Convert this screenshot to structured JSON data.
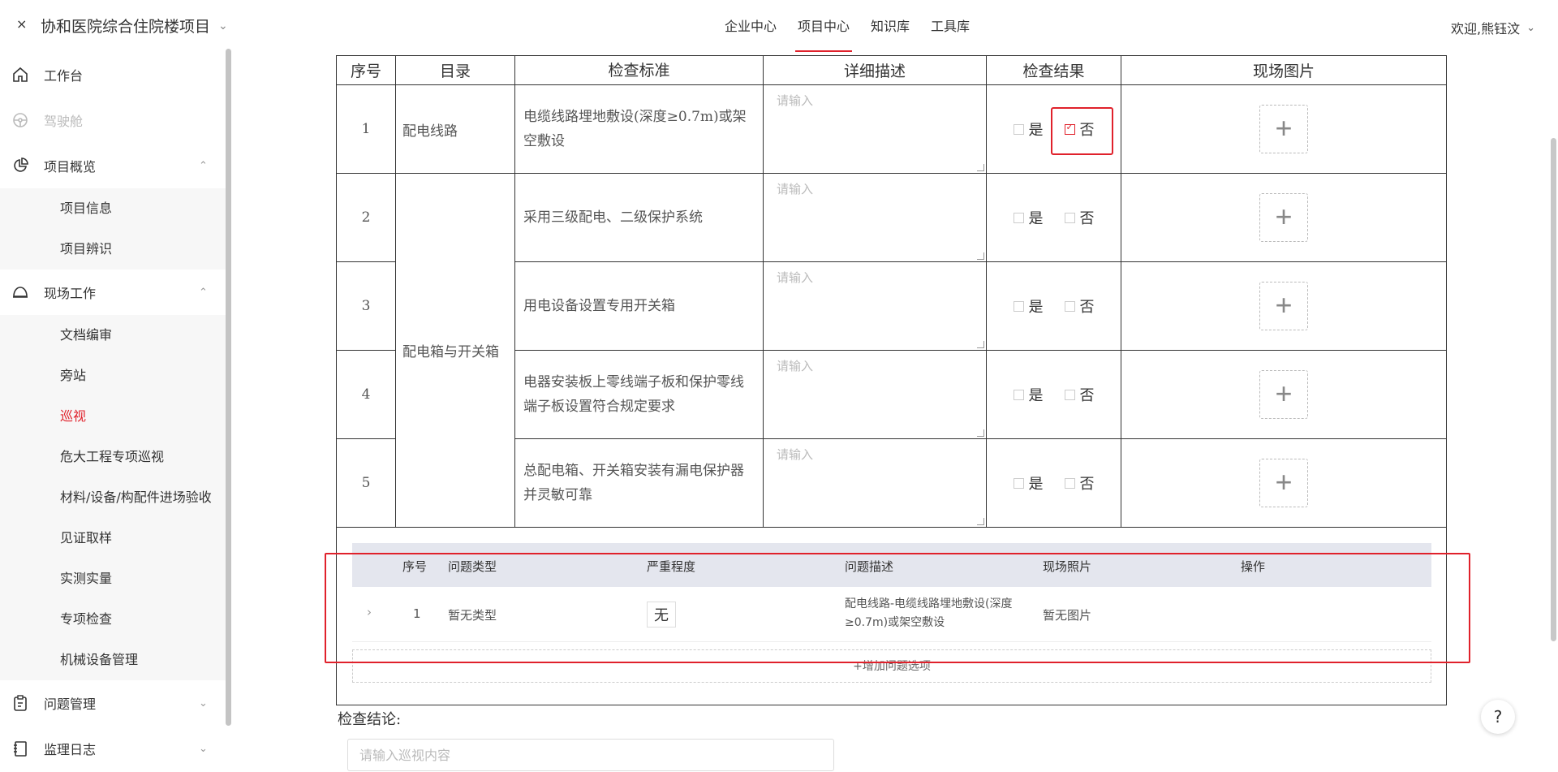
{
  "header": {
    "close_icon": "×",
    "project_name": "协和医院综合住院楼项目",
    "nav": [
      {
        "label": "企业中心",
        "active": false
      },
      {
        "label": "项目中心",
        "active": true
      },
      {
        "label": "知识库",
        "active": false
      },
      {
        "label": "工具库",
        "active": false
      }
    ],
    "user": "欢迎,熊钰汶"
  },
  "sidebar": {
    "workbench": "工作台",
    "cockpit": "驾驶舱",
    "overview": "项目概览",
    "overview_items": [
      "项目信息",
      "项目辨识"
    ],
    "fieldwork": "现场工作",
    "fieldwork_items": [
      "文档编审",
      "旁站",
      "巡视",
      "危大工程专项巡视",
      "材料/设备/构配件进场验收",
      "见证取样",
      "实测实量",
      "专项检查",
      "机械设备管理"
    ],
    "active_item": "巡视",
    "issues": "问题管理",
    "log": "监理日志"
  },
  "table": {
    "headers": [
      "序号",
      "目录",
      "检查标准",
      "详细描述",
      "检查结果",
      "现场图片"
    ],
    "placeholder": "请输入",
    "yes": "是",
    "no": "否",
    "rows": [
      {
        "no": "1",
        "category": "配电线路",
        "standard": "电缆线路埋地敷设(深度≥0.7m)或架空敷设",
        "result": "否"
      },
      {
        "no": "2",
        "category": "配电箱与开关箱",
        "standard": "采用三级配电、二级保护系统",
        "result": ""
      },
      {
        "no": "3",
        "category": "",
        "standard": "用电设备设置专用开关箱",
        "result": ""
      },
      {
        "no": "4",
        "category": "",
        "standard": "电器安装板上零线端子板和保护零线端子板设置符合规定要求",
        "result": ""
      },
      {
        "no": "5",
        "category": "",
        "standard": "总配电箱、开关箱安装有漏电保护器并灵敏可靠",
        "result": ""
      }
    ]
  },
  "issues_table": {
    "headers": [
      "序号",
      "问题类型",
      "严重程度",
      "问题描述",
      "现场照片",
      "操作"
    ],
    "rows": [
      {
        "no": "1",
        "type": "暂无类型",
        "severity": "无",
        "description": "配电线路-电缆线路埋地敷设(深度≥0.7m)或架空敷设",
        "photo": "暂无图片"
      }
    ],
    "add_label": "+增加问题选项"
  },
  "conclusion": {
    "label": "检查结论:",
    "placeholder": "请输入巡视内容"
  },
  "help": "?",
  "colors": {
    "accent": "#e0212b"
  }
}
